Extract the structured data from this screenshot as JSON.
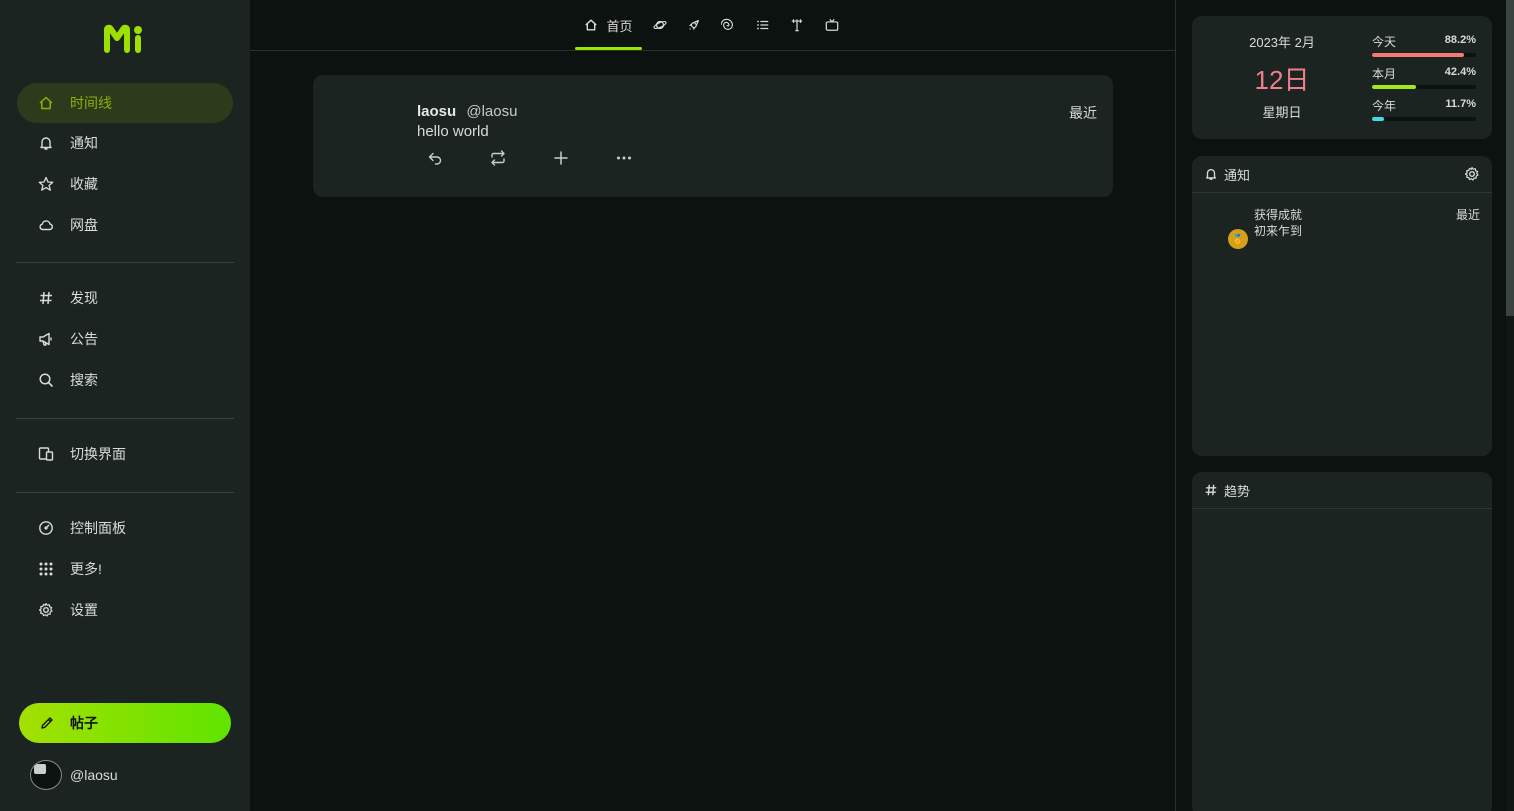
{
  "sidebar": {
    "items": [
      {
        "label": "时间线",
        "icon": "home-icon",
        "active": true
      },
      {
        "label": "通知",
        "icon": "bell-icon"
      },
      {
        "label": "收藏",
        "icon": "star-icon"
      },
      {
        "label": "网盘",
        "icon": "cloud-icon"
      },
      {
        "label": "发现",
        "icon": "hashtag-icon"
      },
      {
        "label": "公告",
        "icon": "megaphone-icon"
      },
      {
        "label": "搜索",
        "icon": "search-icon"
      },
      {
        "label": "切换界面",
        "icon": "devices-icon"
      },
      {
        "label": "控制面板",
        "icon": "dashboard-icon"
      },
      {
        "label": "更多!",
        "icon": "grid-dots-icon"
      },
      {
        "label": "设置",
        "icon": "gear-icon"
      }
    ],
    "post_button": "帖子",
    "account": "@laosu"
  },
  "tabs": [
    {
      "label": "首页",
      "icon": "home-icon",
      "active": true
    },
    {
      "icon": "planet-icon"
    },
    {
      "icon": "rocket-icon"
    },
    {
      "icon": "galaxy-icon"
    },
    {
      "icon": "list-icon"
    },
    {
      "icon": "antenna-icon"
    },
    {
      "icon": "tv-icon"
    }
  ],
  "note": {
    "name": "laosu",
    "username": "@laosu",
    "time": "最近",
    "text": "hello world",
    "actions": [
      "reply-icon",
      "renote-icon",
      "plus-icon",
      "more-icon"
    ]
  },
  "calendar": {
    "month": "2023年  2月",
    "day": "12日",
    "weekday": "星期日",
    "stats": [
      {
        "label": "今天",
        "value": "88.2%",
        "fraction": 0.882,
        "color": "#f57b72"
      },
      {
        "label": "本月",
        "value": "42.4%",
        "fraction": 0.424,
        "color": "#a1e81f"
      },
      {
        "label": "今年",
        "value": "11.7%",
        "fraction": 0.117,
        "color": "#41dbe8"
      }
    ]
  },
  "notifications": {
    "title": "通知",
    "item": {
      "title": "获得成就",
      "subtitle": "初来乍到",
      "time": "最近",
      "badge": "🏅"
    }
  },
  "trends": {
    "title": "趋势"
  },
  "colors": {
    "accent": "#86b300",
    "bg": "#0c1210",
    "panel": "#1c2421"
  }
}
